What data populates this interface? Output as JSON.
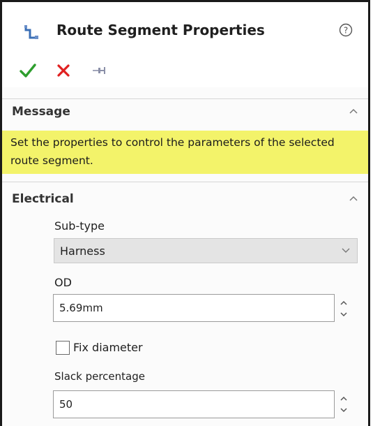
{
  "header": {
    "title": "Route Segment Properties",
    "title_icon": "route-segment-icon",
    "help_icon": "help-icon"
  },
  "actions": {
    "ok_icon": "checkmark-icon",
    "cancel_icon": "close-icon",
    "pin_icon": "pushpin-icon",
    "ok_color": "#2e9e2e",
    "cancel_color": "#e02020"
  },
  "message_section": {
    "title": "Message",
    "text": "Set the properties to control the parameters of the selected route segment.",
    "highlight_color": "#f3f36a"
  },
  "electrical_section": {
    "title": "Electrical",
    "subtype": {
      "label": "Sub-type",
      "value": "Harness"
    },
    "od": {
      "label": "OD",
      "value": "5.69mm"
    },
    "fix_diameter": {
      "label": "Fix diameter",
      "checked": false
    },
    "slack": {
      "label": "Slack percentage",
      "value": "50"
    }
  }
}
